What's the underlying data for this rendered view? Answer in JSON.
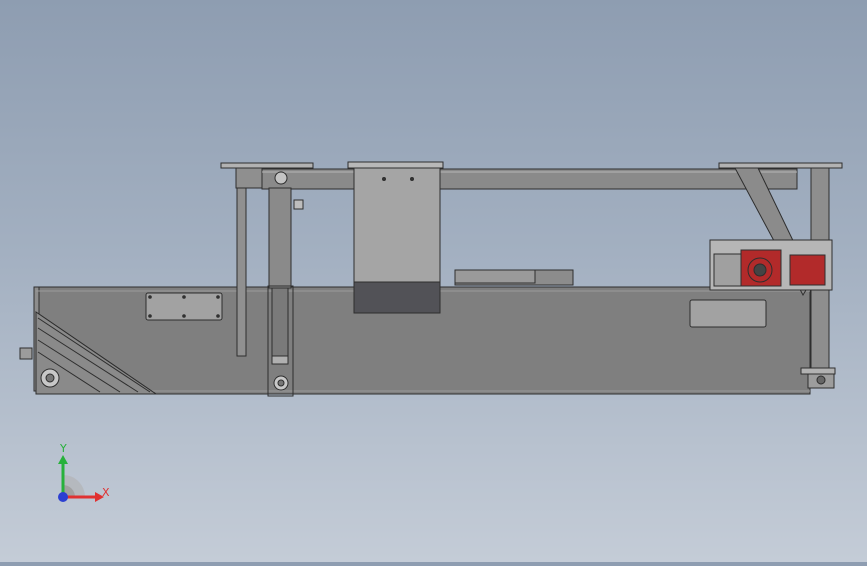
{
  "viewport": {
    "background_top": "#8e9db1",
    "background_bottom": "#c4ccd7"
  },
  "model": {
    "frame_color": "#7f7f7f",
    "frame_light": "#a8a8a8",
    "panel_color": "#a2a2a2",
    "shutter_color": "#525257",
    "motor_color": "#b22a2a",
    "edge_color": "#2e2e2e"
  },
  "triad": {
    "x_label": "X",
    "y_label": "Y",
    "x_color": "#e03131",
    "y_color": "#27b13b",
    "z_color": "#2b3fd1"
  }
}
